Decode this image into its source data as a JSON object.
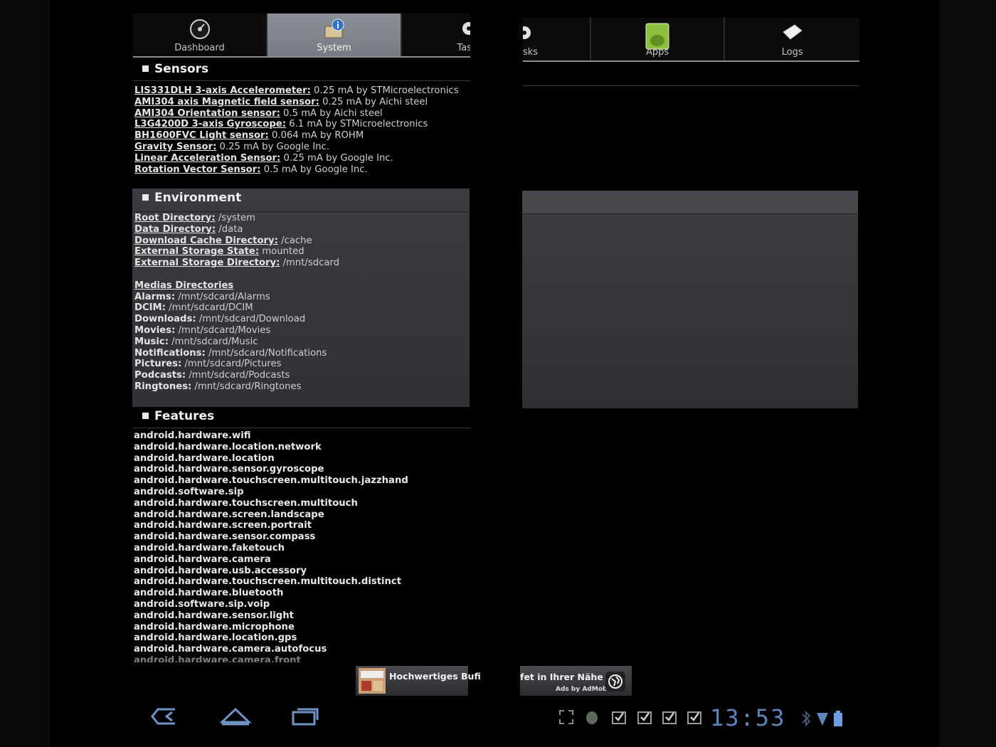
{
  "tabs_left": [
    {
      "label": "Dashboard",
      "icon": "dashboard-icon",
      "active": false
    },
    {
      "label": "System",
      "icon": "system-info-icon",
      "active": true
    },
    {
      "label": "Tas",
      "icon": "tasks-gear-icon",
      "active": false
    }
  ],
  "tabs_right": [
    {
      "label": "sks",
      "icon": "tasks-gear-icon",
      "active": false
    },
    {
      "label": "Apps",
      "icon": "apps-android-icon",
      "active": false
    },
    {
      "label": "Logs",
      "icon": "logs-eraser-icon",
      "active": false
    }
  ],
  "sensors": {
    "title": "Sensors",
    "items": [
      {
        "name": "LIS331DLH 3-axis Accelerometer:",
        "detail": " 0.25 mA by STMicroelectronics"
      },
      {
        "name": "AMI304 axis Magnetic field sensor:",
        "detail": " 0.25 mA by Aichi steel"
      },
      {
        "name": "AMI304 Orientation sensor:",
        "detail": " 0.5 mA by Aichi steel"
      },
      {
        "name": "L3G4200D 3-axis Gyroscope:",
        "detail": " 6.1 mA by STMicroelectronics"
      },
      {
        "name": "BH1600FVC Light sensor:",
        "detail": " 0.064 mA by ROHM"
      },
      {
        "name": "Gravity Sensor:",
        "detail": " 0.25 mA by Google Inc."
      },
      {
        "name": "Linear Acceleration Sensor:",
        "detail": " 0.25 mA by Google Inc."
      },
      {
        "name": "Rotation Vector Sensor:",
        "detail": " 0.5 mA by Google Inc."
      }
    ]
  },
  "environment": {
    "title": "Environment",
    "dirs": [
      {
        "name": "Root Directory:",
        "value": " /system"
      },
      {
        "name": "Data Directory:",
        "value": " /data"
      },
      {
        "name": "Download Cache Directory:",
        "value": " /cache"
      },
      {
        "name": "External Storage State:",
        "value": " mounted"
      },
      {
        "name": "External Storage Directory:",
        "value": " /mnt/sdcard"
      }
    ],
    "medias_title": "Medias Directories",
    "medias": [
      {
        "name": "Alarms:",
        "value": " /mnt/sdcard/Alarms"
      },
      {
        "name": "DCIM:",
        "value": " /mnt/sdcard/DCIM"
      },
      {
        "name": "Downloads:",
        "value": " /mnt/sdcard/Download"
      },
      {
        "name": "Movies:",
        "value": " /mnt/sdcard/Movies"
      },
      {
        "name": "Music:",
        "value": " /mnt/sdcard/Music"
      },
      {
        "name": "Notifications:",
        "value": " /mnt/sdcard/Notifications"
      },
      {
        "name": "Pictures:",
        "value": " /mnt/sdcard/Pictures"
      },
      {
        "name": "Podcasts:",
        "value": " /mnt/sdcard/Podcasts"
      },
      {
        "name": "Ringtones:",
        "value": " /mnt/sdcard/Ringtones"
      }
    ]
  },
  "features": {
    "title": "Features",
    "items": [
      "android.hardware.wifi",
      "android.hardware.location.network",
      "android.hardware.location",
      "android.hardware.sensor.gyroscope",
      "android.hardware.touchscreen.multitouch.jazzhand",
      "android.software.sip",
      "android.hardware.touchscreen.multitouch",
      "android.hardware.screen.landscape",
      "android.hardware.screen.portrait",
      "android.hardware.sensor.compass",
      "android.hardware.faketouch",
      "android.hardware.camera",
      "android.hardware.usb.accessory",
      "android.hardware.touchscreen.multitouch.distinct",
      "android.hardware.bluetooth",
      "android.software.sip.voip",
      "android.hardware.sensor.light",
      "android.hardware.microphone",
      "android.hardware.location.gps",
      "android.hardware.camera.autofocus",
      "android.hardware.camera.front"
    ]
  },
  "ad": {
    "text_left": "Hochwertiges Bufi",
    "text_right": "fet in Ihrer Nähe",
    "by": "Ads by AdMob"
  },
  "system_bar": {
    "clock": "13:53",
    "nav": [
      "back-icon",
      "home-icon",
      "recent-apps-icon"
    ],
    "status_icons": [
      "expand-icon",
      "android-debug-icon",
      "download-done-icon",
      "download-done-icon",
      "download-done-icon",
      "download-done-icon",
      "bluetooth-icon",
      "wifi-icon",
      "battery-icon"
    ]
  },
  "colors": {
    "accent": "#5f86b8",
    "tab_active": "#858990",
    "panel": "#34363b"
  }
}
